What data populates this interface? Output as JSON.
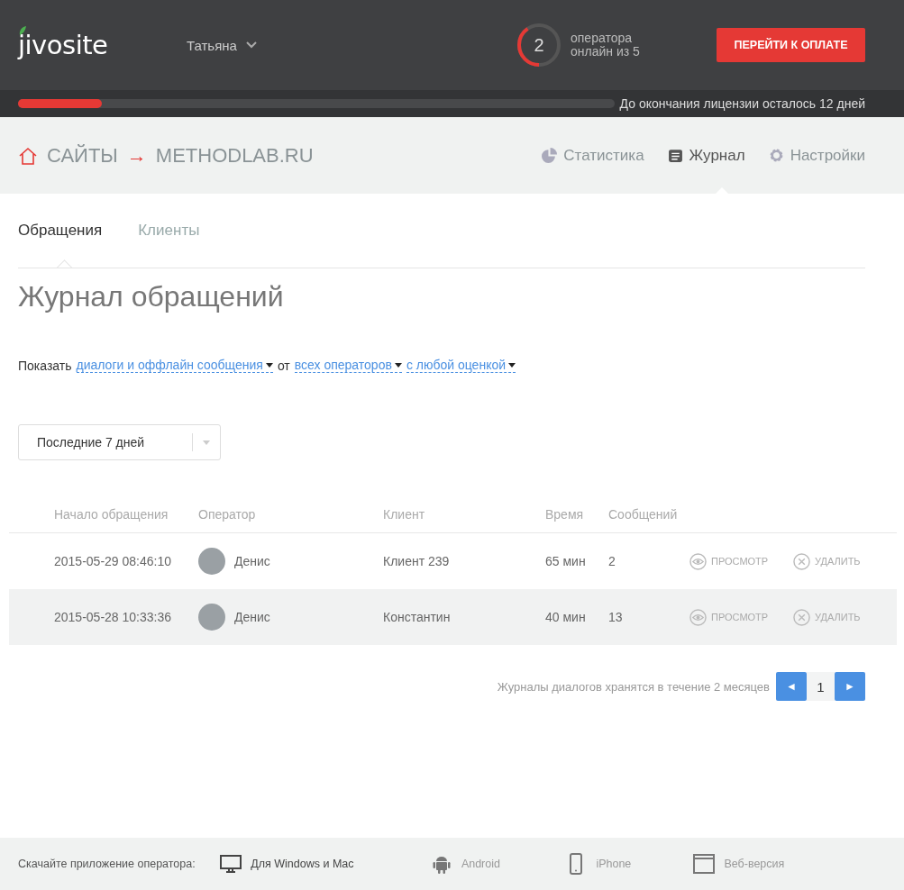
{
  "header": {
    "logo": "jivosite",
    "user": "Татьяна",
    "operators": {
      "count": "2",
      "level": 0.4,
      "caption": "оператора онлайн из 5"
    },
    "pay_button": "ПЕРЕЙТИ К ОПЛАТЕ"
  },
  "license": {
    "level": 0.14,
    "text": "До окончания лицензии осталось 12 дней"
  },
  "breadcrumb": {
    "root": "САЙТЫ",
    "arrow": "→",
    "site": "METHODLAB.RU"
  },
  "nav": [
    {
      "label": "Статистика",
      "selected": false
    },
    {
      "label": "Журнал",
      "selected": true
    },
    {
      "label": "Настройки",
      "selected": false
    }
  ],
  "tabs": [
    {
      "label": "Обращения",
      "selected": true
    },
    {
      "label": "Клиенты",
      "selected": false
    }
  ],
  "title": "Журнал обращений",
  "filter": {
    "label": "Показать",
    "options": [
      {
        "text": "диалоги и оффлайн сообщения"
      },
      {
        "prefix": "от",
        "text": "всех операторов"
      },
      {
        "text": "с любой оценкой"
      }
    ]
  },
  "period": {
    "value": "Последние 7 дней"
  },
  "table": {
    "columns": [
      "Начало обращения",
      "Оператор",
      "Клиент",
      "Время",
      "Сообщений"
    ],
    "rows": [
      {
        "start": "2015-05-29 08:46:10",
        "operator": "Денис",
        "client": "Клиент 239",
        "time": "65 мин",
        "messages": "2",
        "view": "ПРОСМОТР",
        "delete": "УДАЛИТЬ",
        "highlighted": false
      },
      {
        "start": "2015-05-28 10:33:36",
        "operator": "Денис",
        "client": "Константин",
        "time": "40 мин",
        "messages": "13",
        "view": "ПРОСМОТР",
        "delete": "УДАЛИТЬ",
        "highlighted": true
      }
    ]
  },
  "retention_note": "Журналы диалогов хранятся в течение 2 месяцев",
  "pagination": {
    "prev": "◄",
    "page": "1",
    "next": "►"
  },
  "footer": {
    "label": "Скачайте приложение оператора:",
    "apps": [
      {
        "label": "Для Windows и Mac",
        "selected": true
      },
      {
        "label": "Android",
        "selected": false
      },
      {
        "label": "iPhone",
        "selected": false
      },
      {
        "label": "Веб-версия",
        "selected": false
      }
    ]
  }
}
